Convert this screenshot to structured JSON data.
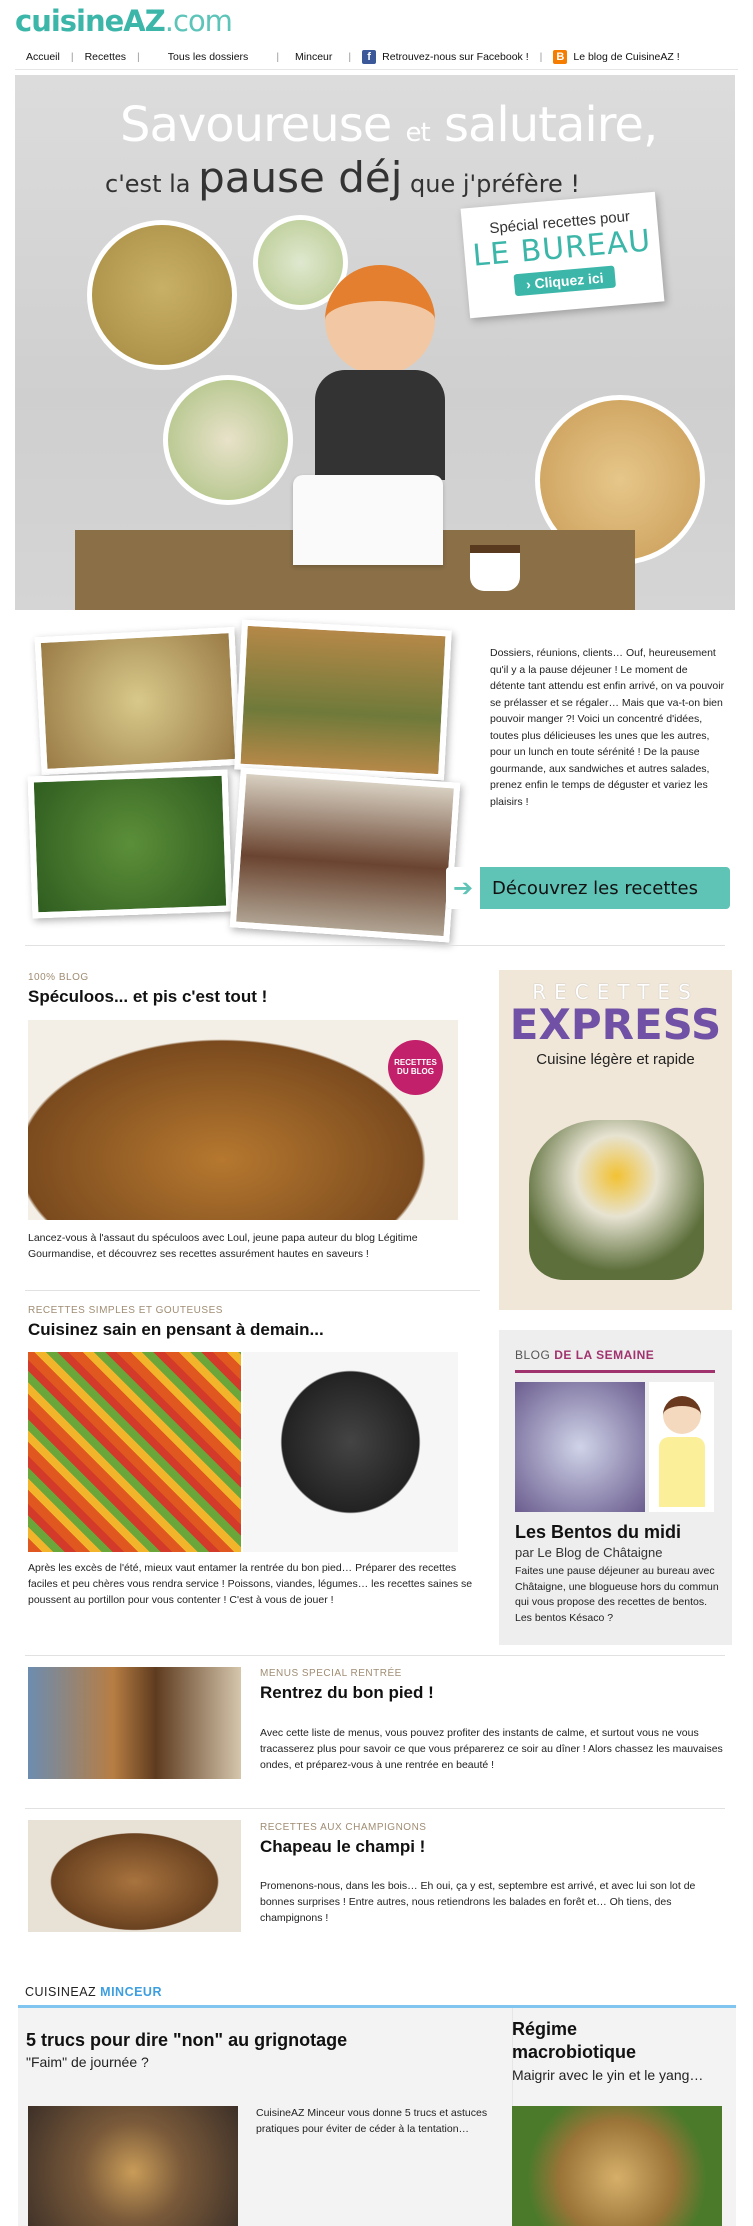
{
  "header": {
    "logo": {
      "part1": "cuisine",
      "part2": "AZ",
      "part3": ".com"
    },
    "nav": [
      {
        "label": "Accueil"
      },
      {
        "label": "Recettes"
      },
      {
        "label": "Tous les dossiers"
      },
      {
        "label": "Minceur"
      },
      {
        "label": "Retrouvez-nous sur Facebook !"
      },
      {
        "label": "Le blog de CuisineAZ !"
      }
    ]
  },
  "hero": {
    "line1a": "Savoureuse",
    "line1b": "et",
    "line1c": "salutaire,",
    "line2a": "c'est la",
    "line2b": "pause déj",
    "line2c": "que j'préfère !",
    "bureau_kicker": "Spécial recettes pour",
    "bureau_title": "LE BUREAU",
    "bureau_button": "› Cliquez ici"
  },
  "intro": {
    "text": "Dossiers, réunions, clients… Ouf, heureusement qu'il y a la pause déjeuner ! Le moment de détente tant attendu est enfin arrivé, on va pouvoir se prélasser et se régaler… Mais que va-t-on bien pouvoir manger ?! Voici un concentré d'idées, toutes plus délicieuses les unes que les autres, pour un lunch en toute sérénité ! De la pause gourmande, aux sandwiches et autres salades, prenez enfin le temps de déguster et variez les plaisirs !",
    "cta": "Découvrez les recettes"
  },
  "article1": {
    "kicker": "100% BLOG",
    "title": "Spéculoos... et pis c'est tout !",
    "badge": "RECETTES DU BLOG",
    "text": "Lancez-vous à l'assaut du spéculoos avec Loul, jeune papa auteur du blog Légitime Gourmandise, et découvrez ses recettes assurément hautes en saveurs !"
  },
  "express": {
    "recettes": "RECETTES",
    "express": "EXPRESS",
    "subtitle": "Cuisine légère et rapide"
  },
  "article2": {
    "kicker": "RECETTES SIMPLES ET GOUTEUSES",
    "title": "Cuisinez sain en pensant à demain...",
    "text": "Après les excès de l'été, mieux vaut entamer la rentrée du bon pied… Préparer des recettes faciles et peu chères vous rendra service ! Poissons, viandes, légumes… les recettes saines se poussent au portillon pour vous contenter ! C'est à vous de jouer !"
  },
  "blog_week": {
    "head1": "BLOG ",
    "head2": "DE LA SEMAINE",
    "title": "Les Bentos du midi",
    "byline": "par Le Blog de Châtaigne",
    "text": "Faites une pause déjeuner au bureau avec Châtaigne, une blogueuse hors du commun qui vous propose des recettes de bentos. Les bentos Késaco ?"
  },
  "article3": {
    "kicker": "MENUS SPECIAL RENTRÉE",
    "title": "Rentrez du bon pied !",
    "text": "Avec cette liste de menus, vous pouvez profiter des instants de calme, et surtout vous ne vous tracasserez plus pour savoir ce que vous préparerez ce soir au dîner ! Alors chassez les mauvaises ondes, et préparez-vous à une rentrée en beauté !"
  },
  "article4": {
    "kicker": "RECETTES AUX CHAMPIGNONS",
    "title": "Chapeau le champi !",
    "text": "Promenons-nous, dans les bois… Eh oui, ça y est, septembre est arrivé, et avec lui son lot de bonnes surprises ! Entre autres, nous retiendrons les balades en forêt et… Oh tiens, des champignons !"
  },
  "minceur": {
    "head1": "CUISINEAZ ",
    "head2": "MINCEUR",
    "left_title": "5 trucs pour dire \"non\" au grignotage",
    "left_sub": "\"Faim\" de journée ?",
    "left_text": "CuisineAZ Minceur vous donne 5 trucs et astuces pratiques pour éviter de céder à la tentation…",
    "right_title": "Régime macrobiotique",
    "right_sub": "Maigrir avec le yin et le yang…"
  },
  "colors": {
    "accent": "#3bb6a9",
    "kicker": "#a08d73",
    "blog": "#a0336e",
    "minceur": "#3d9ee0",
    "express": "#7051a6"
  }
}
